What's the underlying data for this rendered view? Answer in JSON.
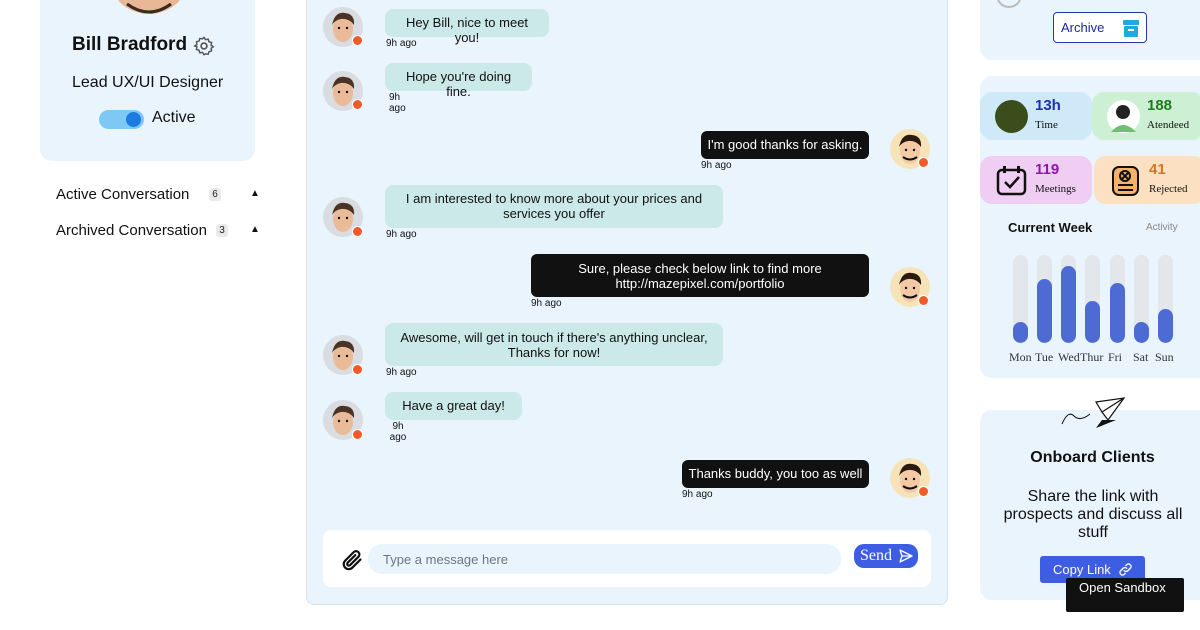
{
  "profile": {
    "name": "Bill Bradford",
    "role": "Lead UX/UI Designer",
    "status": "Active",
    "status_on": true
  },
  "conversations": [
    {
      "label": "Active Conversation",
      "count": "6"
    },
    {
      "label": "Archived Conversation",
      "count": "3"
    }
  ],
  "messages": [
    {
      "side": "in",
      "text": "Hey Bill, nice to meet you!",
      "time": "9h ago"
    },
    {
      "side": "in",
      "text": "Hope you're doing fine.",
      "time": "9h ago"
    },
    {
      "side": "out",
      "text": "I'm good thanks for asking.",
      "time": "9h ago"
    },
    {
      "side": "in",
      "text": "I am interested to know more about your prices and services you offer",
      "time": "9h ago"
    },
    {
      "side": "out",
      "text": "Sure, please check below link to find more http://mazepixel.com/portfolio",
      "time": "9h ago"
    },
    {
      "side": "in",
      "text": "Awesome, will get in touch if there's anything unclear, Thanks for now!",
      "time": "9h ago"
    },
    {
      "side": "in",
      "text": "Have a great day!",
      "time": "9h ago"
    },
    {
      "side": "out",
      "text": "Thanks buddy, you too as well",
      "time": "9h ago"
    }
  ],
  "composer": {
    "placeholder": "Type a message here",
    "send_label": "Send"
  },
  "archive": {
    "label": "Archive"
  },
  "stats": [
    {
      "value": "13h",
      "label": "Time",
      "color": "#1a2fb5",
      "bg": "#cfe9f8"
    },
    {
      "value": "188",
      "label": "Atendeed",
      "color": "#1e7a1e",
      "bg": "#cdf0d5"
    },
    {
      "value": "119",
      "label": "Meetings",
      "color": "#8a1aa8",
      "bg": "#f0cdf2"
    },
    {
      "value": "41",
      "label": "Rejected",
      "color": "#d9751a",
      "bg": "#fbe0c2"
    }
  ],
  "week": {
    "title": "Current Week",
    "subtitle": "Activity",
    "days": [
      "Mon",
      "Tue",
      "Wed",
      "Thur",
      "Fri",
      "Sat",
      "Sun"
    ],
    "levels": [
      0.24,
      0.73,
      0.87,
      0.48,
      0.68,
      0.24,
      0.39
    ]
  },
  "onboard": {
    "title": "Onboard Clients",
    "text": "Share the link with prospects and discuss all stuff",
    "button": "Copy Link"
  },
  "sandbox": {
    "label": "Open Sandbox"
  },
  "colors": {
    "accent": "#3d5de2",
    "panel": "#eaf4fd",
    "status_dot": "#f2592a"
  }
}
